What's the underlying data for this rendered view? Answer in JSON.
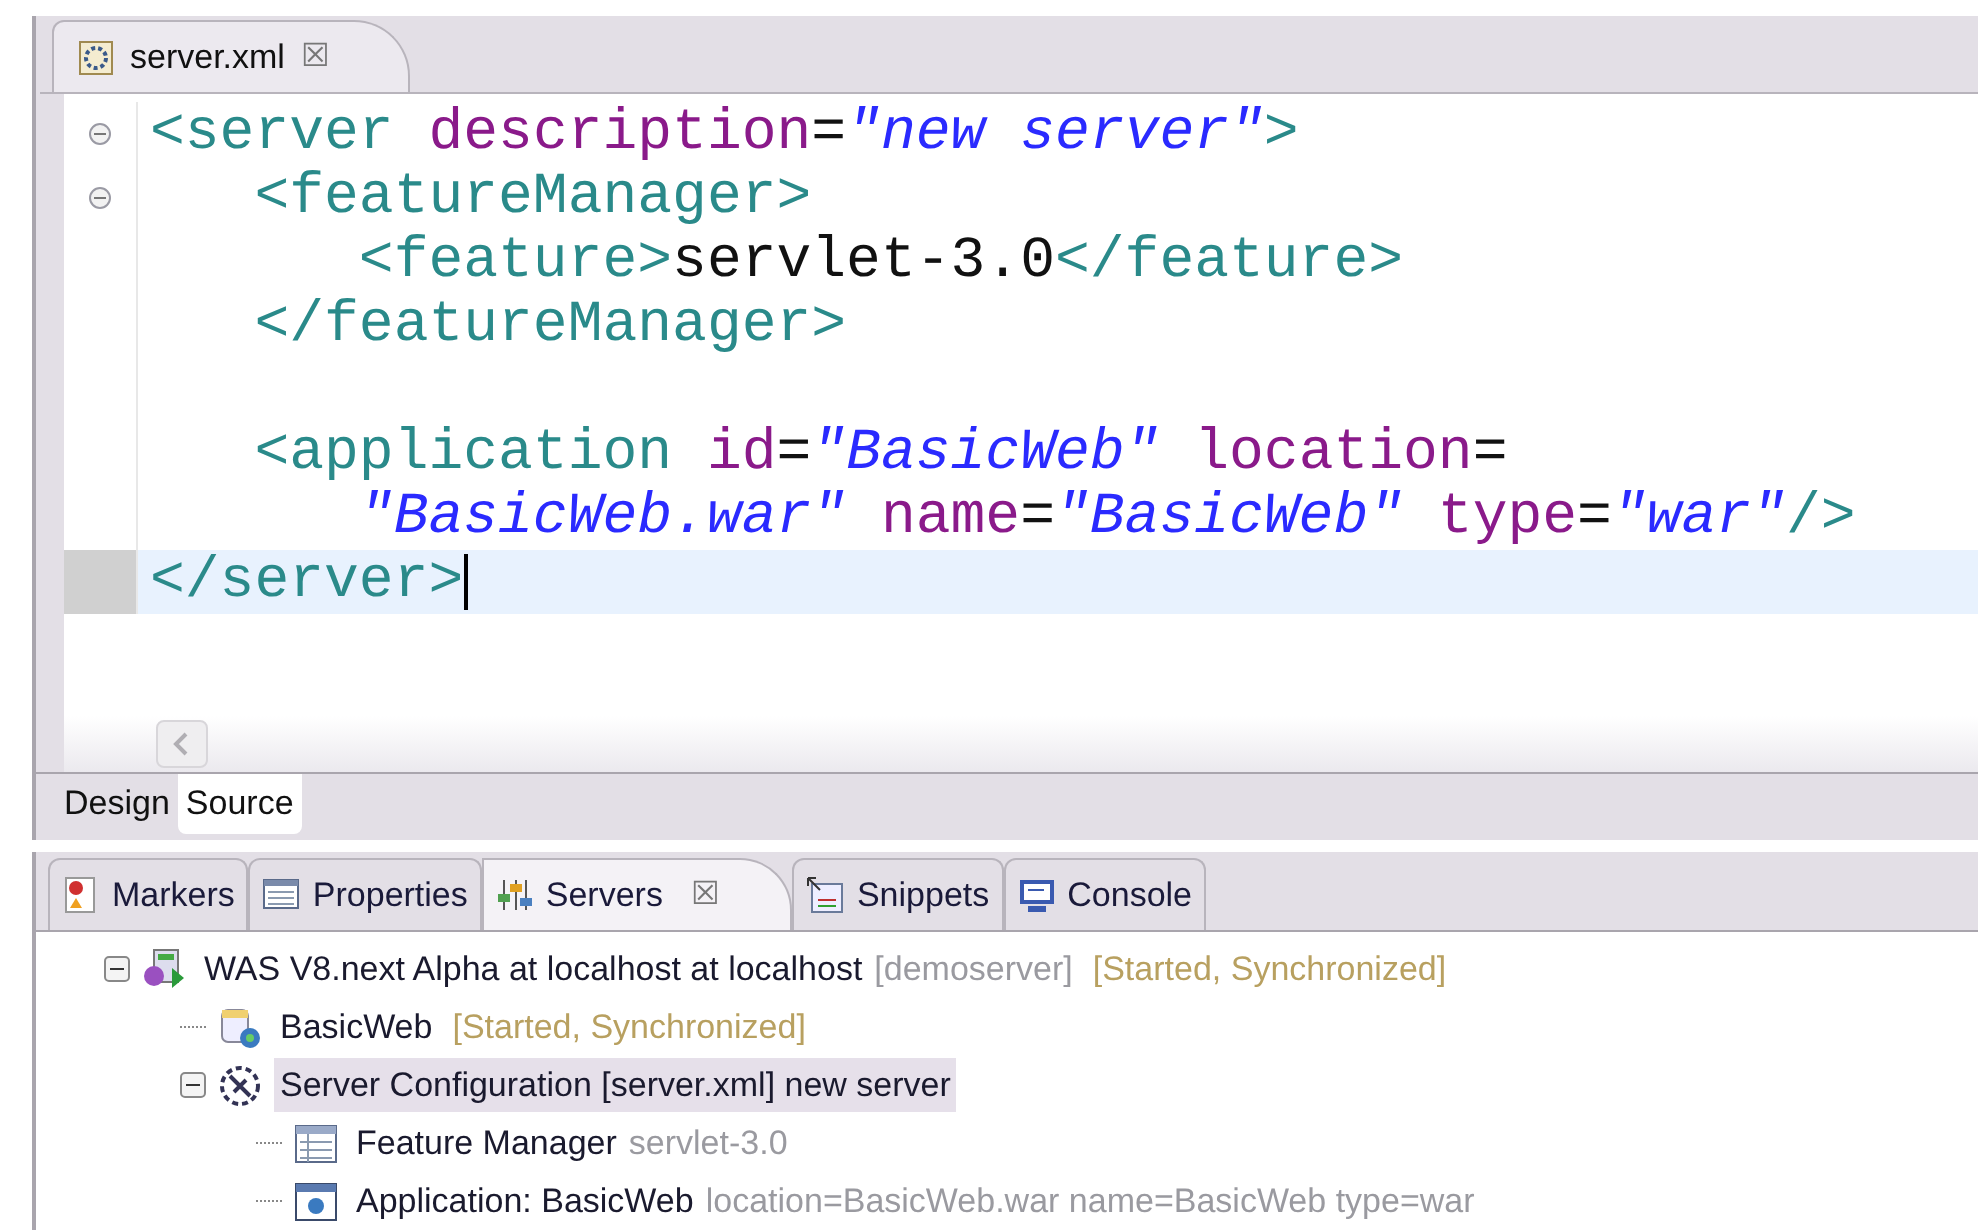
{
  "editor": {
    "tab": {
      "label": "server.xml",
      "close": "☒"
    },
    "lines": [
      {
        "fold": true,
        "tokens": [
          {
            "kind": "tag",
            "text": "<server "
          },
          {
            "kind": "attr",
            "text": "description"
          },
          {
            "kind": "eq",
            "text": "="
          },
          {
            "kind": "value",
            "text": "\"new server\""
          },
          {
            "kind": "tag",
            "text": ">"
          }
        ]
      },
      {
        "fold": true,
        "tokens": [
          {
            "kind": "tag",
            "text": "   <featureManager>"
          }
        ]
      },
      {
        "tokens": [
          {
            "kind": "tag",
            "text": "      <feature>"
          },
          {
            "kind": "text",
            "text": "servlet-3.0"
          },
          {
            "kind": "tag",
            "text": "</feature>"
          }
        ]
      },
      {
        "tokens": [
          {
            "kind": "tag",
            "text": "   </featureManager>"
          }
        ]
      },
      {
        "spaced": true,
        "tokens": [
          {
            "kind": "tag",
            "text": "   <application "
          },
          {
            "kind": "attr",
            "text": "id"
          },
          {
            "kind": "eq",
            "text": "="
          },
          {
            "kind": "value",
            "text": "\"BasicWeb\""
          },
          {
            "kind": "attr",
            "text": " location"
          },
          {
            "kind": "eq",
            "text": "="
          }
        ]
      },
      {
        "tokens": [
          {
            "kind": "value",
            "text": "      \"BasicWeb.war\""
          },
          {
            "kind": "attr",
            "text": " name"
          },
          {
            "kind": "eq",
            "text": "="
          },
          {
            "kind": "value",
            "text": "\"BasicWeb\""
          },
          {
            "kind": "attr",
            "text": " type"
          },
          {
            "kind": "eq",
            "text": "="
          },
          {
            "kind": "value",
            "text": "\"war\""
          },
          {
            "kind": "tag",
            "text": "/>"
          }
        ]
      },
      {
        "current": true,
        "tokens": [
          {
            "kind": "tag",
            "text": "</server>"
          }
        ]
      }
    ],
    "mode_tabs": [
      {
        "label": "Design",
        "selected": false
      },
      {
        "label": "Source",
        "selected": true
      }
    ]
  },
  "panel": {
    "tabs": [
      {
        "label": "Markers",
        "kind": "markers",
        "selected": false
      },
      {
        "label": "Properties",
        "kind": "properties",
        "selected": false
      },
      {
        "label": "Servers",
        "kind": "servers",
        "selected": true,
        "close": "☒"
      },
      {
        "label": "Snippets",
        "kind": "snippets",
        "selected": false
      },
      {
        "label": "Console",
        "kind": "console",
        "selected": false
      }
    ],
    "tree": [
      {
        "label": "WAS V8.next Alpha at localhost at localhost",
        "kind": "server",
        "expanded": true,
        "selected": false,
        "decorations": [
          {
            "kind": "qualifier",
            "text": "[demoserver]"
          },
          {
            "kind": "status",
            "text": "[Started, Synchronized]"
          }
        ],
        "children": [
          {
            "label": "BasicWeb",
            "kind": "module",
            "selected": false,
            "decorations": [
              {
                "kind": "status",
                "text": "[Started, Synchronized]"
              }
            ]
          },
          {
            "label": "Server Configuration [server.xml] new server",
            "kind": "config",
            "expanded": true,
            "selected": true,
            "children": [
              {
                "label": "Feature Manager",
                "kind": "table",
                "selected": false,
                "decorations": [
                  {
                    "kind": "qualifier",
                    "text": "servlet-3.0"
                  }
                ]
              },
              {
                "label": "Application: BasicWeb",
                "kind": "app",
                "selected": false,
                "decorations": [
                  {
                    "kind": "qualifier",
                    "text": "location=BasicWeb.war name=BasicWeb type=war"
                  }
                ]
              }
            ]
          }
        ]
      }
    ]
  }
}
